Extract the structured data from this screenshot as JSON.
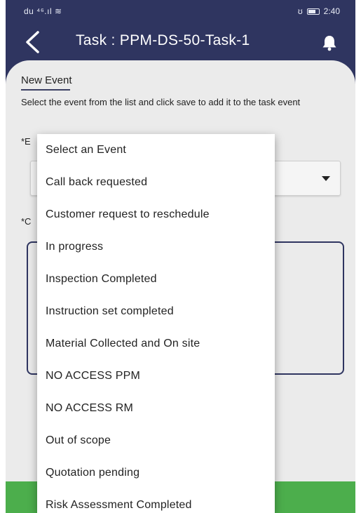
{
  "status_bar": {
    "left": "du ⁴⁶.ıl ≋",
    "right_icons": "ʊ",
    "time": "2:40"
  },
  "app_bar": {
    "title": "Task : PPM-DS-50-Task-1",
    "back_icon": "chevron-left",
    "bell_icon": "bell"
  },
  "form": {
    "heading": "New Event",
    "description": "Select the event from the list and click save to add it to the task event",
    "event_label": "*E",
    "comment_label": "*C"
  },
  "dropdown": {
    "options": [
      "Select an Event",
      "Call back requested",
      "Customer request to reschedule",
      "In progress",
      "Inspection Completed",
      "Instruction set completed",
      "Material Collected and On site",
      "NO ACCESS PPM",
      "NO ACCESS RM",
      "Out of scope",
      "Quotation pending",
      "Risk Assessment Completed"
    ]
  },
  "colors": {
    "primary": "#2f3560",
    "card": "#ebebeb",
    "accent_green": "#4cae4c"
  }
}
